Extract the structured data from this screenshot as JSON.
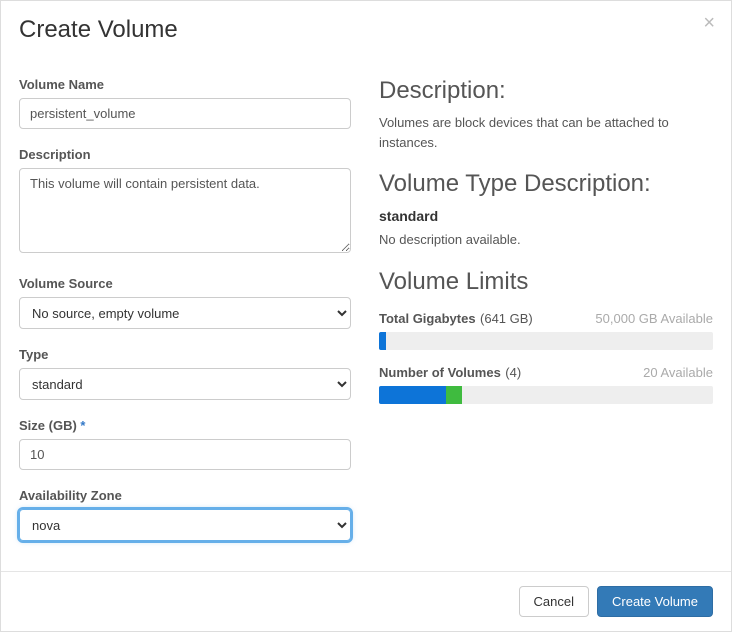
{
  "modal": {
    "title": "Create Volume"
  },
  "form": {
    "volume_name": {
      "label": "Volume Name",
      "value": "persistent_volume"
    },
    "description": {
      "label": "Description",
      "value": "This volume will contain persistent data."
    },
    "volume_source": {
      "label": "Volume Source",
      "value": "No source, empty volume"
    },
    "type": {
      "label": "Type",
      "value": "standard"
    },
    "size": {
      "label": "Size (GB)",
      "required_mark": "*",
      "value": "10"
    },
    "availability_zone": {
      "label": "Availability Zone",
      "value": "nova"
    }
  },
  "info": {
    "description_heading": "Description:",
    "description_text": "Volumes are block devices that can be attached to instances.",
    "type_desc_heading": "Volume Type Description:",
    "type_desc_name": "standard",
    "type_desc_text": "No description available.",
    "limits_heading": "Volume Limits",
    "limits": {
      "gigabytes": {
        "label": "Total Gigabytes",
        "used_text": "(641 GB)",
        "available_text": "50,000 GB Available",
        "used_pct": 1.3
      },
      "volumes": {
        "label": "Number of Volumes",
        "used_text": "(4)",
        "available_text": "20 Available",
        "blue_pct": 20,
        "green_pct": 5
      }
    }
  },
  "footer": {
    "cancel": "Cancel",
    "submit": "Create Volume"
  }
}
